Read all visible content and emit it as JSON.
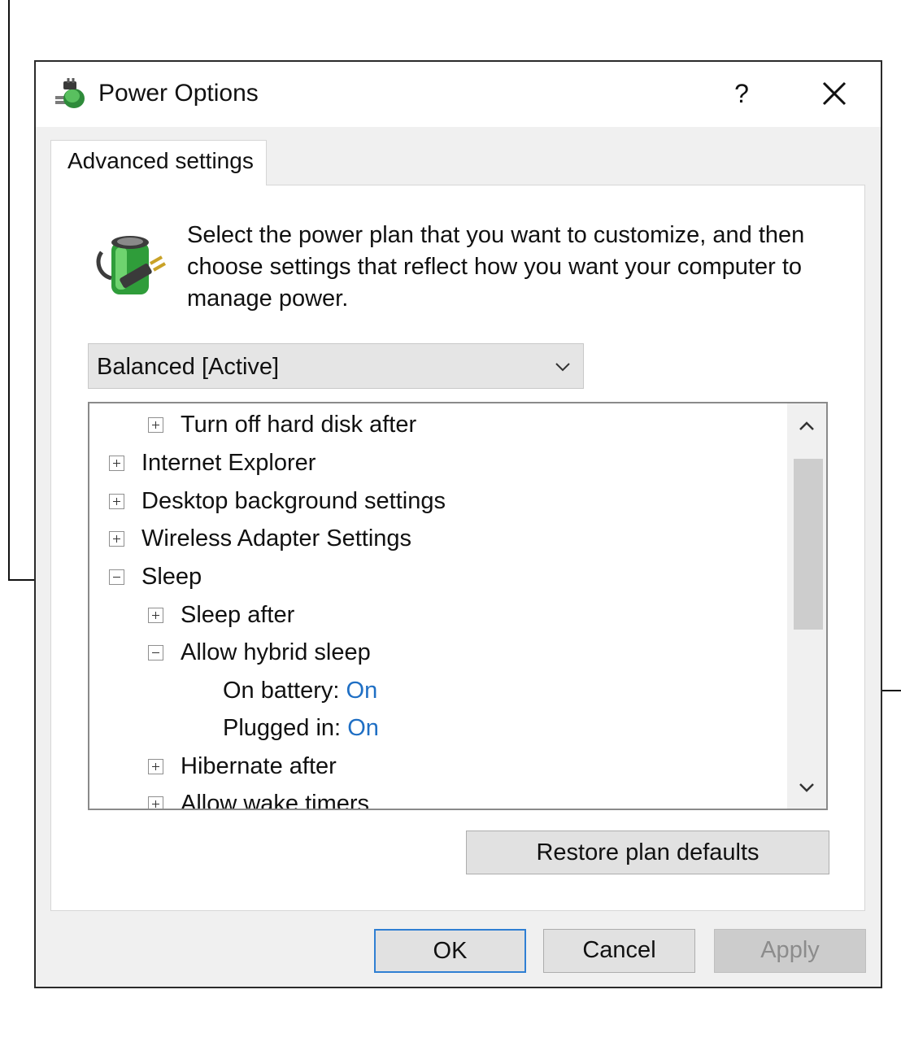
{
  "window": {
    "title": "Power Options",
    "help_label": "?",
    "icons": {
      "app": "power-plug-icon",
      "close": "close-icon"
    }
  },
  "tab": {
    "label": "Advanced settings"
  },
  "intro": {
    "text": "Select the power plan that you want to customize, and then choose settings that reflect how you want your computer to manage power.",
    "icon": "battery-plug-icon"
  },
  "plan_select": {
    "value": "Balanced [Active]"
  },
  "tree": {
    "items": [
      {
        "label": "Turn off hard disk after",
        "expander": "plus"
      },
      {
        "label": "Internet Explorer",
        "expander": "plus"
      },
      {
        "label": "Desktop background settings",
        "expander": "plus"
      },
      {
        "label": "Wireless Adapter Settings",
        "expander": "plus"
      },
      {
        "label": "Sleep",
        "expander": "minus"
      },
      {
        "label": "Sleep after",
        "expander": "plus"
      },
      {
        "label": "Allow hybrid sleep",
        "expander": "minus"
      },
      {
        "label": "On battery:",
        "value": "On"
      },
      {
        "label": "Plugged in:",
        "value": "On"
      },
      {
        "label": "Hibernate after",
        "expander": "plus"
      },
      {
        "label": "Allow wake timers",
        "expander": "plus"
      }
    ]
  },
  "buttons": {
    "restore": "Restore plan defaults",
    "ok": "OK",
    "cancel": "Cancel",
    "apply": "Apply"
  },
  "colors": {
    "link": "#1f6fc4",
    "focus_border": "#2f7fd3"
  }
}
